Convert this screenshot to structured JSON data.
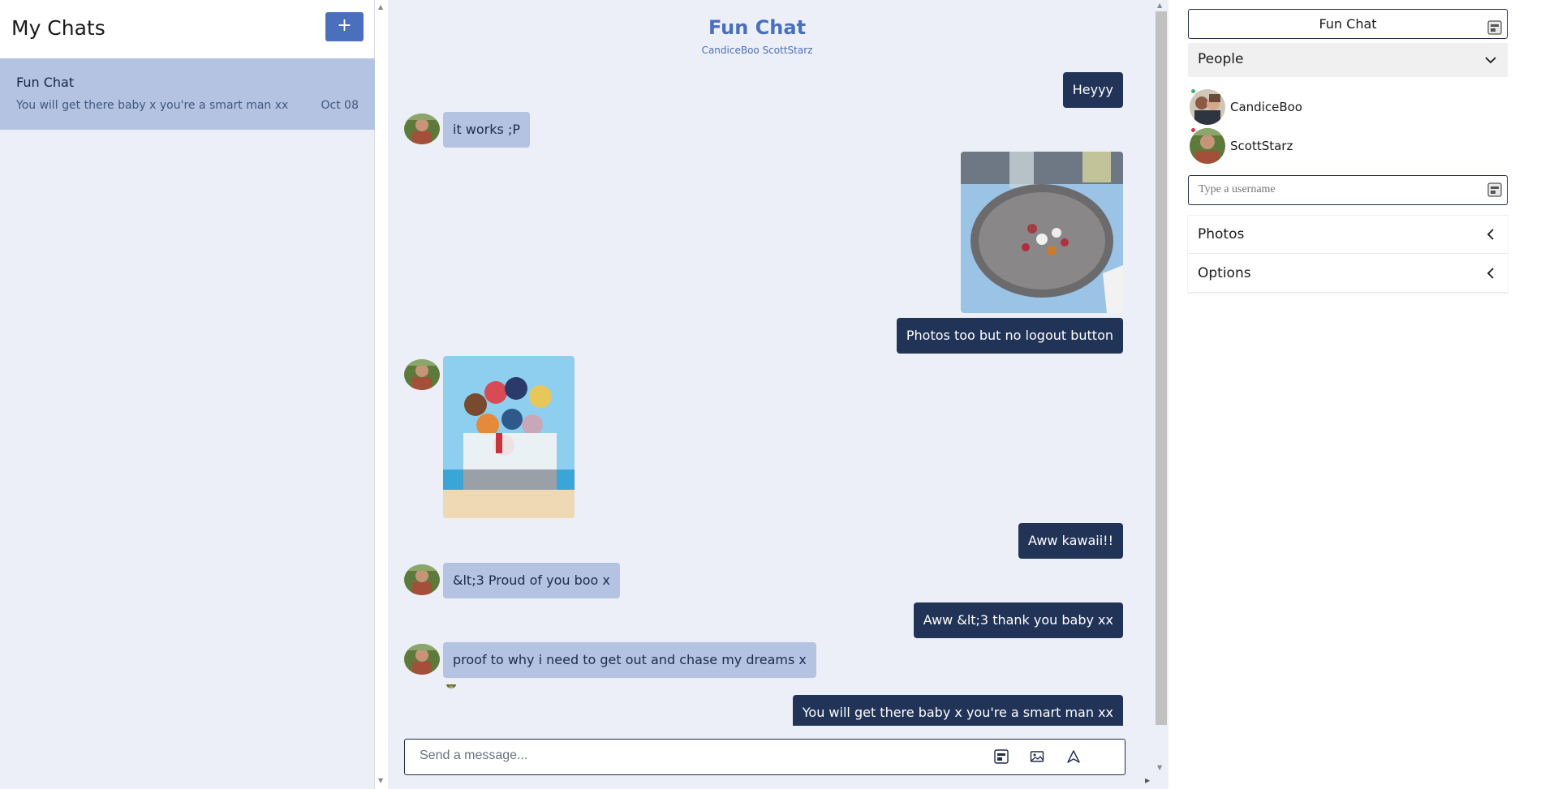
{
  "sidebar": {
    "title": "My Chats",
    "new_chat_label": "+",
    "chats": [
      {
        "title": "Fun Chat",
        "last_message": "You will get there baby x you're a smart man xx",
        "date": "Oct 08"
      }
    ]
  },
  "chat": {
    "title": "Fun Chat",
    "members": "CandiceBoo ScottStarz",
    "messages": [
      {
        "direction": "out",
        "type": "text",
        "text": "Heyyy"
      },
      {
        "direction": "in",
        "type": "text",
        "text": "it works ;P"
      },
      {
        "direction": "out",
        "type": "image",
        "description": "food-plate-photo"
      },
      {
        "direction": "out",
        "type": "text",
        "text": "Photos too but no logout button"
      },
      {
        "direction": "in",
        "type": "image",
        "description": "anime-group-image"
      },
      {
        "direction": "out",
        "type": "text",
        "text": "Aww kawaii!!"
      },
      {
        "direction": "in",
        "type": "text",
        "text": "&lt;3 Proud of you boo x"
      },
      {
        "direction": "out",
        "type": "text",
        "text": "Aww &lt;3 thank you baby xx"
      },
      {
        "direction": "in",
        "type": "text",
        "text": "proof to why i need to get out and chase my dreams x"
      },
      {
        "direction": "out",
        "type": "text",
        "text": "You will get there baby x you're a smart man xx"
      }
    ],
    "input": {
      "placeholder": "Send a message..."
    },
    "input_icons": [
      "attach-icon",
      "image-icon",
      "send-icon"
    ]
  },
  "details": {
    "title": "Fun Chat",
    "people_label": "People",
    "people": [
      {
        "name": "CandiceBoo",
        "status_color": "#3cb371"
      },
      {
        "name": "ScottStarz",
        "status_color": "#e0303a"
      }
    ],
    "username_placeholder": "Type a username",
    "photos_label": "Photos",
    "options_label": "Options"
  },
  "colors": {
    "accent": "#4a6fbd",
    "outgoing_bubble": "#213357",
    "incoming_bubble": "#b4c3e1",
    "background": "#eceff7"
  }
}
